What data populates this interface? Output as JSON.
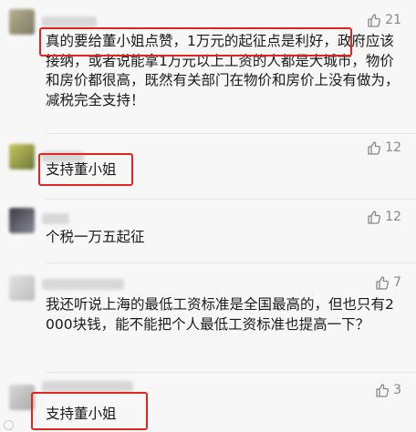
{
  "colors": {
    "accent_highlight": "#e0241f",
    "like_color": "#888888"
  },
  "icons": {
    "like": "thumbs-up-icon"
  },
  "comments": [
    {
      "likes": "21",
      "text": "真的要给董小姐点赞，1万元的起征点是利好，政府应该接纳，或者说能拿1万元以上工资的人都是大城市，物价和房价都很高，既然有关部门在物价和房价上没有做为，减税完全支持！",
      "highlighted": "真的要给董小姐点赞，1万元的起征点是利好，"
    },
    {
      "likes": "12",
      "text": "支持董小姐",
      "highlighted": "支持董小姐"
    },
    {
      "likes": "12",
      "text": "个税一万五起征"
    },
    {
      "likes": "7",
      "text": "我还听说上海的最低工资标准是全国最高的，但也只有2000块钱，能不能把个人最低工资标准也提高一下？"
    },
    {
      "likes": "3",
      "text": "支持董小姐",
      "highlighted": "支持董小姐"
    }
  ]
}
